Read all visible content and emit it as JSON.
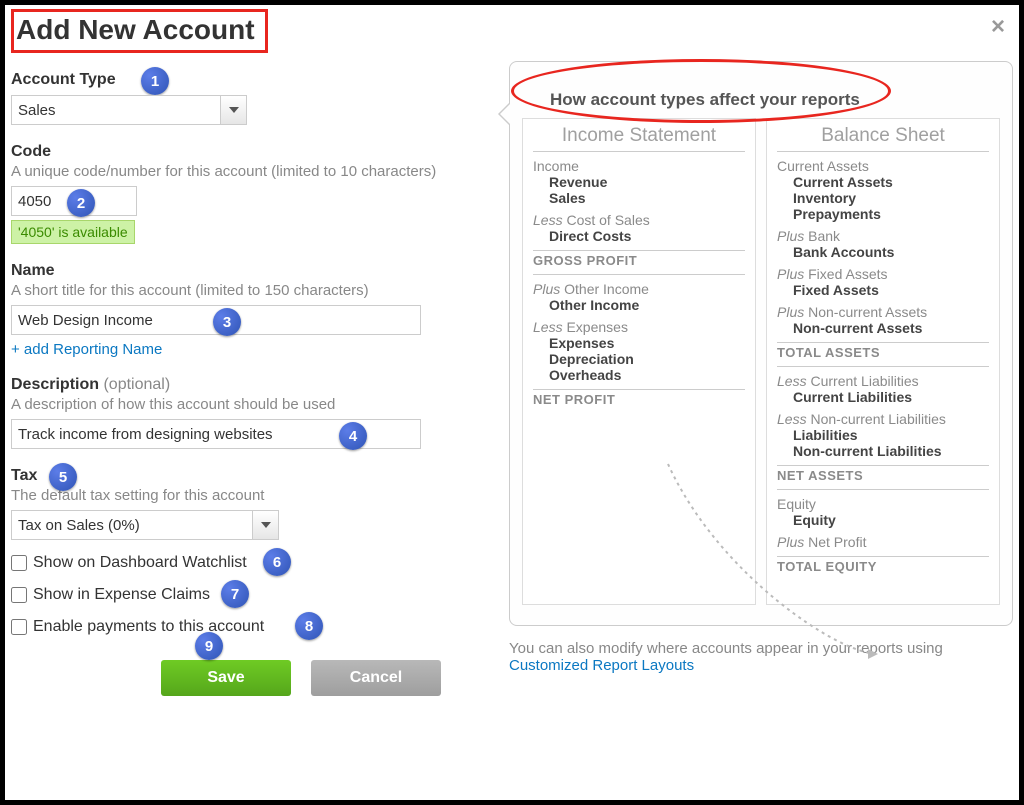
{
  "title": "Add New Account",
  "close_icon": "×",
  "fields": {
    "account_type": {
      "label": "Account Type",
      "value": "Sales"
    },
    "code": {
      "label": "Code",
      "hint": "A unique code/number for this account (limited to 10 characters)",
      "value": "4050",
      "avail_msg": "'4050' is available"
    },
    "name": {
      "label": "Name",
      "hint": "A short title for this account (limited to 150 characters)",
      "value": "Web Design Income",
      "add_link": "+ add Reporting Name"
    },
    "description": {
      "label": "Description",
      "optional": "(optional)",
      "hint": "A description of how this account should be used",
      "value": "Track income from designing websites"
    },
    "tax": {
      "label": "Tax",
      "hint": "The default tax setting for this account",
      "value": "Tax on Sales (0%)"
    },
    "checks": {
      "dashboard": "Show on Dashboard Watchlist",
      "expense": "Show in Expense Claims",
      "payments": "Enable payments to this account"
    }
  },
  "buttons": {
    "save": "Save",
    "cancel": "Cancel"
  },
  "badges": [
    "1",
    "2",
    "3",
    "4",
    "5",
    "6",
    "7",
    "8",
    "9"
  ],
  "info": {
    "heading": "How account types affect your reports",
    "income_statement": {
      "title": "Income Statement",
      "sections": [
        {
          "head": "Income",
          "items": [
            "Revenue",
            "Sales"
          ]
        },
        {
          "head_prefix": "Less",
          "head": "Cost of Sales",
          "items": [
            "Direct Costs"
          ]
        }
      ],
      "midline1": "GROSS PROFIT",
      "sections2": [
        {
          "head_prefix": "Plus",
          "head": "Other Income",
          "items": [
            "Other Income"
          ]
        },
        {
          "head_prefix": "Less",
          "head": "Expenses",
          "items": [
            "Expenses",
            "Depreciation",
            "Overheads"
          ]
        }
      ],
      "endline": "NET PROFIT"
    },
    "balance_sheet": {
      "title": "Balance Sheet",
      "sections": [
        {
          "head": "Current Assets",
          "items": [
            "Current Assets",
            "Inventory",
            "Prepayments"
          ]
        },
        {
          "head_prefix": "Plus",
          "head": "Bank",
          "items": [
            "Bank Accounts"
          ]
        },
        {
          "head_prefix": "Plus",
          "head": "Fixed Assets",
          "items": [
            "Fixed Assets"
          ]
        },
        {
          "head_prefix": "Plus",
          "head": "Non-current Assets",
          "items": [
            "Non-current Assets"
          ]
        }
      ],
      "midline1": "TOTAL ASSETS",
      "sections2": [
        {
          "head_prefix": "Less",
          "head": "Current Liabilities",
          "items": [
            "Current Liabilities"
          ]
        },
        {
          "head_prefix": "Less",
          "head": "Non-current Liabilities",
          "items": [
            "Liabilities",
            "Non-current Liabilities"
          ]
        }
      ],
      "midline2": "NET ASSETS",
      "sections3": [
        {
          "head": "Equity",
          "items": [
            "Equity"
          ]
        },
        {
          "head_prefix": "Plus",
          "head": "Net Profit",
          "items": []
        }
      ],
      "endline": "TOTAL EQUITY"
    },
    "footer_pre": "You can also modify where accounts appear in your reports using ",
    "footer_link": "Customized Report Layouts"
  }
}
